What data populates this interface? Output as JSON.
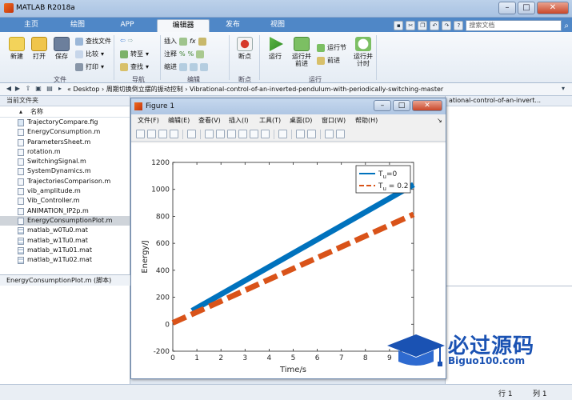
{
  "window": {
    "title": "MATLAB R2018a"
  },
  "tabs": [
    {
      "label": "主页"
    },
    {
      "label": "绘图"
    },
    {
      "label": "APP"
    },
    {
      "label": "编辑器"
    },
    {
      "label": "发布"
    },
    {
      "label": "视图"
    }
  ],
  "search": {
    "placeholder": "搜索文档"
  },
  "ribbon": {
    "file": {
      "new": "新建",
      "open": "打开",
      "save": "保存",
      "find_files": "查找文件",
      "compare": "比较",
      "print": "打印",
      "group": "文件"
    },
    "nav": {
      "goto": "转至",
      "find": "查找",
      "group": "导航"
    },
    "edit": {
      "insert": "插入",
      "comment": "注释",
      "indent": "缩进",
      "group": "编辑"
    },
    "breakpoints": {
      "label": "断点",
      "group": "断点"
    },
    "run": {
      "run": "运行",
      "run_advance": "运行并\n前进",
      "run_section": "运行节",
      "advance": "前进",
      "run_time": "运行并\n计时",
      "group": "运行"
    }
  },
  "address": {
    "path": "« Desktop › 周期切换倒立摆的振动控制 › Vibrational-control-of-an-inverted-pendulum-with-periodically-switching-master"
  },
  "current_folder": {
    "header": "当前文件夹",
    "col_name": "名称",
    "files": [
      {
        "name": "TrajectoryCompare.fig",
        "type": "fig"
      },
      {
        "name": "EnergyConsumption.m",
        "type": "m"
      },
      {
        "name": "ParametersSheet.m",
        "type": "m"
      },
      {
        "name": "rotation.m",
        "type": "m"
      },
      {
        "name": "SwitchingSignal.m",
        "type": "m"
      },
      {
        "name": "SystemDynamics.m",
        "type": "m"
      },
      {
        "name": "TrajectoriesComparison.m",
        "type": "m"
      },
      {
        "name": "vib_amplitude.m",
        "type": "m"
      },
      {
        "name": "Vib_Controller.m",
        "type": "m"
      },
      {
        "name": "ANIMATION_IP2p.m",
        "type": "m"
      },
      {
        "name": "EnergyConsumptionPlot.m",
        "type": "m",
        "selected": true
      },
      {
        "name": "matlab_w0Tu0.mat",
        "type": "mat"
      },
      {
        "name": "matlab_w1Tu0.mat",
        "type": "mat"
      },
      {
        "name": "matlab_w1Tu01.mat",
        "type": "mat"
      },
      {
        "name": "matlab_w1Tu02.mat",
        "type": "mat"
      }
    ],
    "detail": "EnergyConsumptionPlot.m (脚本)"
  },
  "editor_header": "ational-control-of-an-invert...",
  "status": {
    "line_label": "行 1",
    "col_label": "列 1"
  },
  "figure": {
    "title": "Figure 1",
    "menu": [
      "文件(F)",
      "编辑(E)",
      "查看(V)",
      "插入(I)",
      "工具(T)",
      "桌面(D)",
      "窗口(W)",
      "帮助(H)"
    ]
  },
  "watermark": {
    "cn": "必过源码",
    "en": "Biguo100.com"
  },
  "colors": {
    "series1": "#0072bd",
    "series2": "#d95319",
    "ribbon_tab": "#4f87c7"
  },
  "chart_data": {
    "type": "line",
    "xlabel": "Time/s",
    "ylabel": "Energy/J",
    "xlim": [
      0,
      10
    ],
    "ylim": [
      -200,
      1200
    ],
    "xticks": [
      0,
      1,
      2,
      3,
      4,
      5,
      6,
      7,
      8,
      9
    ],
    "yticks": [
      -200,
      0,
      200,
      400,
      600,
      800,
      1000,
      1200
    ],
    "legend_position": "top-right",
    "series": [
      {
        "name": "Tu=0",
        "x": [
          0.8,
          10
        ],
        "y": [
          100,
          1035
        ],
        "style": "solid"
      },
      {
        "name": "Tu=0.2",
        "x": [
          0,
          10
        ],
        "y": [
          10,
          815
        ],
        "style": "dashed"
      }
    ],
    "legend": [
      {
        "label": "T",
        "sub": "u",
        "value": "=0"
      },
      {
        "label": "T",
        "sub": "u",
        "value": " = 0.2"
      }
    ]
  }
}
